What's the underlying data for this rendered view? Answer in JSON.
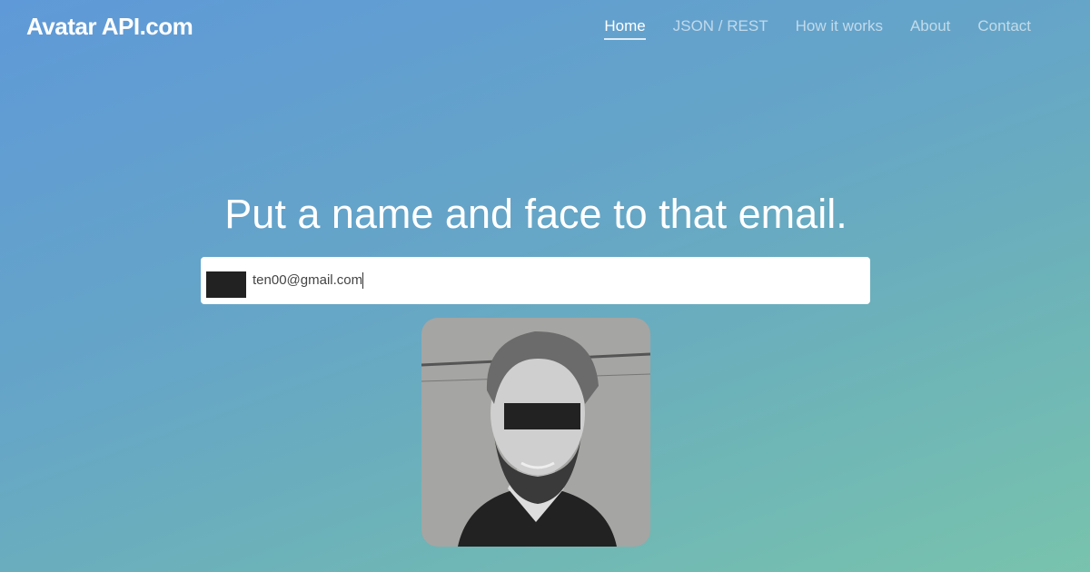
{
  "header": {
    "logo": "Avatar API.com",
    "nav": [
      {
        "label": "Home",
        "active": true
      },
      {
        "label": "JSON / REST"
      },
      {
        "label": "How it works"
      },
      {
        "label": "About"
      },
      {
        "label": "Contact"
      }
    ]
  },
  "hero": {
    "headline": "Put a name and face to that email.",
    "email_value": "ten00@gmail.com"
  },
  "colors": {
    "gradient_start": "#5f99d8",
    "gradient_end": "#78c3ad"
  }
}
